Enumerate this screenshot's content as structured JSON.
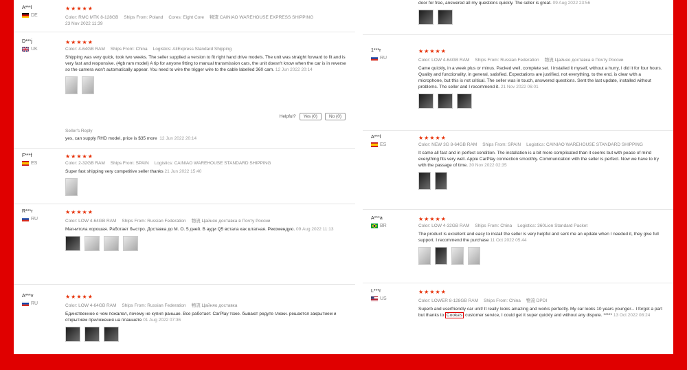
{
  "left": [
    {
      "user": "A***l",
      "country": "DE",
      "stars": "★★★★★",
      "meta": [
        "Color: RMC MTK 8-128GB",
        "Ships From: Poland",
        "Cores: Eight Core",
        "物流 CAINIAO WAREHOUSE EXPRESS SHIPPING"
      ],
      "date": "23 Nov 2022 11:39"
    },
    {
      "user": "D***j",
      "country": "UK",
      "stars": "★★★★★",
      "meta": [
        "Color: 4-64GB RAM",
        "Ships From: China",
        "Logistics: AliExpress Standard Shipping"
      ],
      "text": "Shipping was very quick, took two weeks. The seller supplied a version to fit right hand drive models. The unit was straight forward to fit and is very fast and responsive. (4gb ram model) A tip for anyone fitting to manual transmission cars, the unit doesn't know when the car is in reverse so the camera won't automatically appear. You need to wire the trigger wire to the cable labelled 360 cam.",
      "date": "12 Jun 2022 20:14",
      "helpful": "Helpful?",
      "yes": "Yes (0)",
      "no": "No (0)",
      "reply_label": "Seller's Reply",
      "reply": "yes, can supply RHD model, price is $35 more",
      "reply_date": "12 Jun 2022 20:14"
    },
    {
      "user": "F***f",
      "country": "ES",
      "stars": "★★★★★",
      "meta": [
        "Color: 2-32GB RAM",
        "Ships From: SPAIN",
        "Logistics: CAINIAO WAREHOUSE STANDARD SHIPPING"
      ],
      "text": "Super fast shipping very competitive seller thanks",
      "date": "21 Jun 2022 15:40"
    },
    {
      "user": "R***r",
      "country": "RU",
      "stars": "★★★★★",
      "meta": [
        "Color: LOW 4-64GB RAM",
        "Ships From: Russian Federation",
        "物流 Цайняо доставка в Почту России"
      ],
      "text": "Магнитола хорошая. Работает быстро. Доставка до М. О. 5 дней. В ауди Q5 встала как штатная. Рекомендую.",
      "date": "09 Aug 2022 11:13"
    },
    {
      "user": "A***v",
      "country": "RU",
      "stars": "★★★★★",
      "meta": [
        "Color: LOW 4-64GB RAM",
        "Ships From: Russian Federation",
        "物流 Цайняо доставка"
      ],
      "text": "Единственное о чем пожалел, почему не купил раньше. Все работает. CarPlay тоже. бывают редуте глюки. решается закрытием и открытием приложения на планшете",
      "date": "01 Aug 2022 07:36"
    }
  ],
  "right": [
    {
      "text": "door for free, answered all my questions quickly. The seller is great.",
      "date": "09 Aug 2022 23:56"
    },
    {
      "user": "1***r",
      "country": "RU",
      "stars": "★★★★★",
      "meta": [
        "Color: LOW 4-64GB RAM",
        "Ships From: Russian Federation",
        "物流 Цайняо доставка в Почту России"
      ],
      "text": "Came quickly, in a week plus or minus. Packed well, complete set. I installed it myself, without a hurry, I did it for four hours. Quality and functionality, in general, satisfied. Expectations are justified, not everything, to the end, is clear with a microphone, but this is not critical. The seller was in touch, answered questions. Sent the last update, installed without problems. The seller and I recommend it.",
      "date": "21 Nov 2022 06:01"
    },
    {
      "user": "A***l",
      "country": "ES",
      "stars": "★★★★★",
      "meta": [
        "Color: NEW 3G 8-64GB RAM",
        "Ships From: SPAIN",
        "Logistics: CAINIAO WAREHOUSE STANDARD SHIPPING"
      ],
      "text": "It came all fast and in perfect condition. The installation is a bit more complicated than it seems but with peace of mind everything fits very well. Apple CarPlay connection smoothly. Communication with the seller is perfect. Now we have to try with the passage of time.",
      "date": "30 Nov 2022 02:35"
    },
    {
      "user": "A***a",
      "country": "BR",
      "stars": "★★★★★",
      "meta": [
        "Color: LOW 4-32GB RAM",
        "Ships From: China",
        "Logistics: 360Lion Standard Packet"
      ],
      "text": "The product is excellent and easy to install the seller is very helpful and sent me an update when I needed it, they give full support. I recommend the purchase",
      "date": "11 Oct 2022 05:44"
    },
    {
      "user": "L***r",
      "country": "US",
      "stars": "★★★★★",
      "meta": [
        "Color: LOWER 8-128GB RAM",
        "Ships From: China",
        "物流 DPDI"
      ],
      "text_a": "Superb and userfriendly car unit! It really looks amazing and works perfectly. My car looks 10 years younger... I forgot a part but thanks to ",
      "text_hl": "Cooka's",
      "text_b": " customer service, I could get it super quickly and without any dispute. *****",
      "date": "13 Oct 2022 08:24"
    }
  ]
}
